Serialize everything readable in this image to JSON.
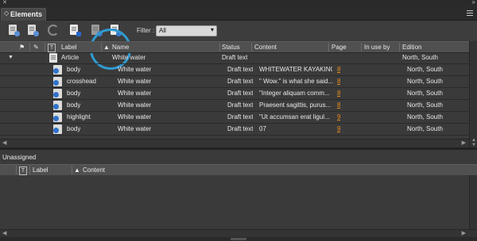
{
  "panel": {
    "title": "Elements",
    "tab_arrows": "◇"
  },
  "toolbar": {
    "filter_label": "Filter :",
    "filter_value": "All",
    "buttons": [
      "place-element-icon",
      "remove-element-icon",
      "refresh-icon",
      "edit-element-icon",
      "check-in-icon",
      "check-out-icon"
    ]
  },
  "table": {
    "columns": {
      "label": "Label",
      "name": "Name",
      "status": "Status",
      "content": "Content",
      "page": "Page",
      "in_use_by": "In use by",
      "edition": "Edition"
    },
    "parent": {
      "label": "Article",
      "name": "White water",
      "status": "Draft text",
      "content": "",
      "page": "",
      "in_use_by": "",
      "edition": "North, South"
    },
    "rows": [
      {
        "label": "body",
        "name": "White water",
        "status": "Draft text",
        "content": "WHITEWATER KAYAKING",
        "page": "8",
        "in_use_by": "",
        "edition": "North, South"
      },
      {
        "label": "crosshead",
        "name": "White water",
        "status": "Draft text",
        "content": "\" Wow.\" is what she said...",
        "page": "8",
        "in_use_by": "",
        "edition": "North, South"
      },
      {
        "label": "body",
        "name": "White water",
        "status": "Draft text",
        "content": "\"Integer aliquam comm...",
        "page": "8",
        "in_use_by": "",
        "edition": "North, South"
      },
      {
        "label": "body",
        "name": "White water",
        "status": "Draft text",
        "content": "Praesent sagittis, purus...",
        "page": "8",
        "in_use_by": "",
        "edition": "North, South"
      },
      {
        "label": "highlight",
        "name": "White water",
        "status": "Draft text",
        "content": "\"Ut accumsan erat ligul...",
        "page": "9",
        "in_use_by": "",
        "edition": "North, South"
      },
      {
        "label": "body",
        "name": "White water",
        "status": "Draft text",
        "content": "07",
        "page": "9",
        "in_use_by": "",
        "edition": "North, South"
      }
    ]
  },
  "unassigned": {
    "title": "Unassigned",
    "columns": {
      "label": "Label",
      "content": "Content"
    }
  },
  "colors": {
    "highlight_circle": "#2f9bd3",
    "page_link": "#e88b1f",
    "component_icon": "#2f72c9"
  }
}
